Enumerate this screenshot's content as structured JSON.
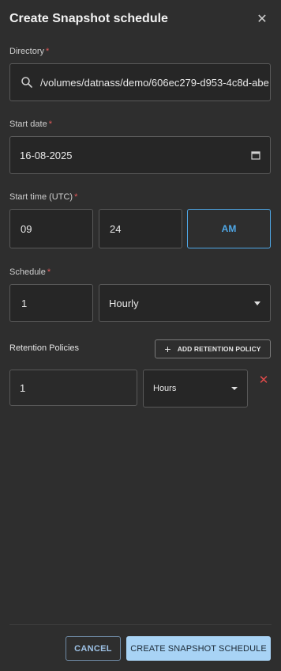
{
  "dialog": {
    "title": "Create Snapshot schedule",
    "close_icon": "close-icon"
  },
  "directory": {
    "label": "Directory",
    "required_mark": "*",
    "value": "/volumes/datnass/demo/606ec279-d953-4c8d-abe",
    "icon": "search-icon"
  },
  "start_date": {
    "label": "Start date",
    "required_mark": "*",
    "value": "16-08-2025",
    "icon": "calendar-icon"
  },
  "start_time": {
    "label": "Start time (UTC)",
    "required_mark": "*",
    "hour": "09",
    "minute": "24",
    "period": "AM"
  },
  "schedule": {
    "label": "Schedule",
    "required_mark": "*",
    "interval": "1",
    "frequency": "Hourly"
  },
  "retention": {
    "label": "Retention Policies",
    "add_button": "ADD RETENTION POLICY",
    "policies": [
      {
        "count": "1",
        "unit": "Hours"
      }
    ]
  },
  "footer": {
    "cancel": "CANCEL",
    "create": "CREATE SNAPSHOT SCHEDULE"
  },
  "colors": {
    "accent": "#4fa8e8",
    "primary_button": "#a8d3f5",
    "required": "#e35a5a",
    "delete": "#e04a4a",
    "background": "#2e2e2e"
  }
}
